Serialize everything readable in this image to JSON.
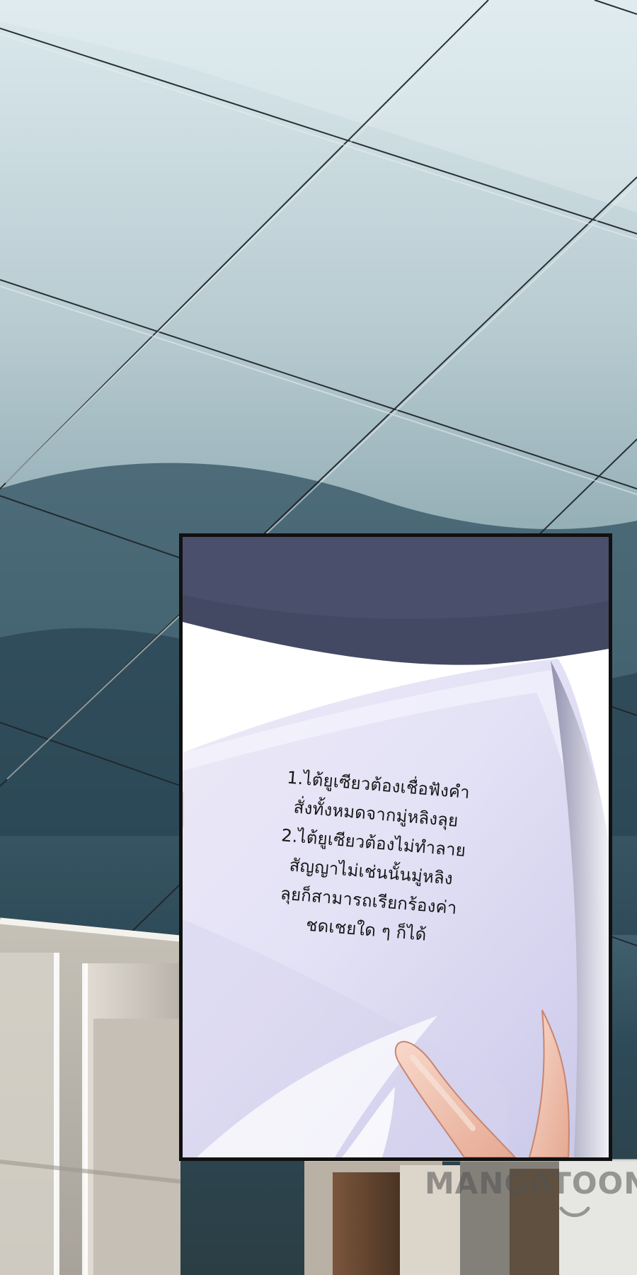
{
  "contract": {
    "lines": [
      "1.ไต้ยูเซียวต้องเชื่อฟังคำ",
      "สั่งทั้งหมดจากมู่หลิงลุย",
      "2.ไต้ยูเซียวต้องไม่ทำลาย",
      "สัญญาไม่เช่นนั้นมู่หลิง",
      "ลุยก็สามารถเรียกร้องค่า",
      "ชดเชยใด ๆ ก็ได้"
    ]
  },
  "watermark": {
    "text": "MANGATOON"
  }
}
